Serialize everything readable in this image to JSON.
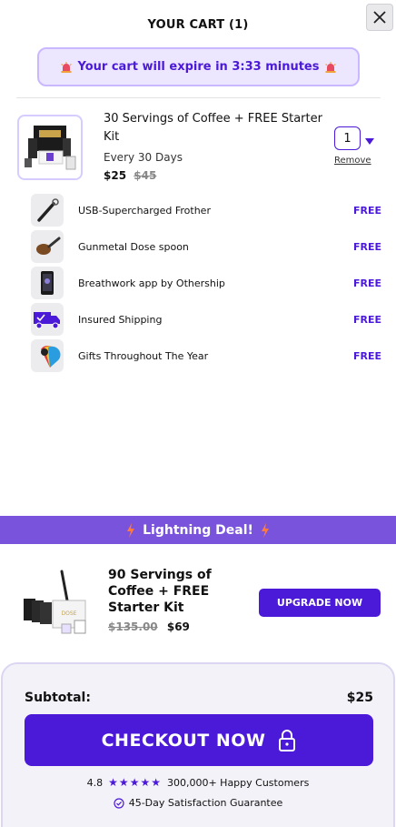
{
  "header": {
    "title": "YOUR CART (1)"
  },
  "banner": {
    "text": "Your cart will expire in 3:33 minutes"
  },
  "item": {
    "title": "30 Servings of Coffee + FREE Starter Kit",
    "frequency": "Every 30 Days",
    "price": "$25",
    "old_price": "$45",
    "quantity": "1",
    "remove_label": "Remove"
  },
  "perks": [
    {
      "label": "USB-Supercharged Frother",
      "value": "FREE",
      "icon": "frother-icon"
    },
    {
      "label": "Gunmetal Dose spoon",
      "value": "FREE",
      "icon": "spoon-icon"
    },
    {
      "label": "Breathwork app by Othership",
      "value": "FREE",
      "icon": "phone-app-icon"
    },
    {
      "label": "Insured Shipping",
      "value": "FREE",
      "icon": "truck-icon"
    },
    {
      "label": "Gifts Throughout The Year",
      "value": "FREE",
      "icon": "gift-icon"
    }
  ],
  "deal": {
    "banner": "Lightning Deal!",
    "title": "90 Servings of Coffee + FREE Starter Kit",
    "old_price": "$135.00",
    "price": "$69",
    "button": "UPGRADE NOW"
  },
  "checkout": {
    "subtotal_label": "Subtotal:",
    "subtotal_value": "$25",
    "button": "CHECKOUT NOW",
    "rating": "4.8",
    "stars": "★★★★★",
    "customers": "300,000+ Happy Customers",
    "guarantee": "45-Day Satisfaction Guarantee"
  },
  "colors": {
    "accent": "#4b19d8",
    "deal": "#7a53dd",
    "banner_bg": "#ece6ff"
  }
}
